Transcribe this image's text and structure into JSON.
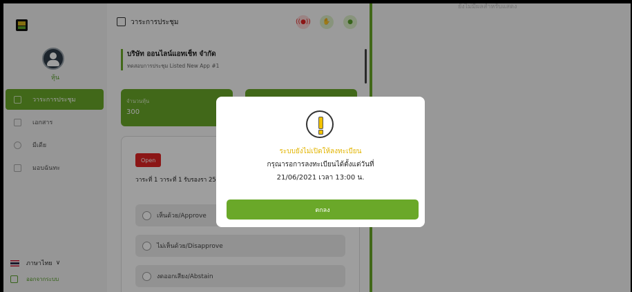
{
  "sidebar": {
    "user_role": "หุ้น",
    "items": [
      {
        "label": "วาระการประชุม",
        "icon": "agenda-icon"
      },
      {
        "label": "เอกสาร",
        "icon": "document-icon"
      },
      {
        "label": "มีเดีย",
        "icon": "media-icon"
      },
      {
        "label": "มอบฉันทะ",
        "icon": "proxy-icon"
      }
    ],
    "language": "ภาษาไทย",
    "logout": "ออกจากระบบ"
  },
  "main": {
    "title": "วาระการประชุม",
    "header_buttons": [
      "live-icon",
      "raise-hand-icon",
      "chat-icon"
    ],
    "company_name": "บริษัท ออนไลน์แอทเช็ท จำกัด",
    "company_sub": "ทดสอบการประชุม Listed New App #1",
    "cards": [
      {
        "label": "จำนวนหุ้น",
        "value": "300"
      },
      {
        "label": "",
        "value": ""
      }
    ],
    "status_badge": "Open",
    "agenda_text": "วาระที่ 1 วาระที่ 1 รับรองรา 2563 เมื่อวันที่ 31 สิงหาคม",
    "vote_options": [
      "เห็นด้วย/Approve",
      "ไม่เห็นด้วย/Disapprove",
      "งดออกเสียง/Abstain"
    ]
  },
  "right": {
    "empty_text": "ยังไม่มีผลสำหรับแสดง"
  },
  "modal": {
    "title": "ระบบยังไม่เปิดให้ลงทะเบียน",
    "message": "กรุณารอการลงทะเบียนได้ตั้งแต่วันที่",
    "datetime": "21/06/2021 เวลา 13:00 น.",
    "ok_label": "ตกลง"
  },
  "colors": {
    "accent": "#6aa829",
    "danger": "#e02424",
    "warning": "#f2c200"
  }
}
